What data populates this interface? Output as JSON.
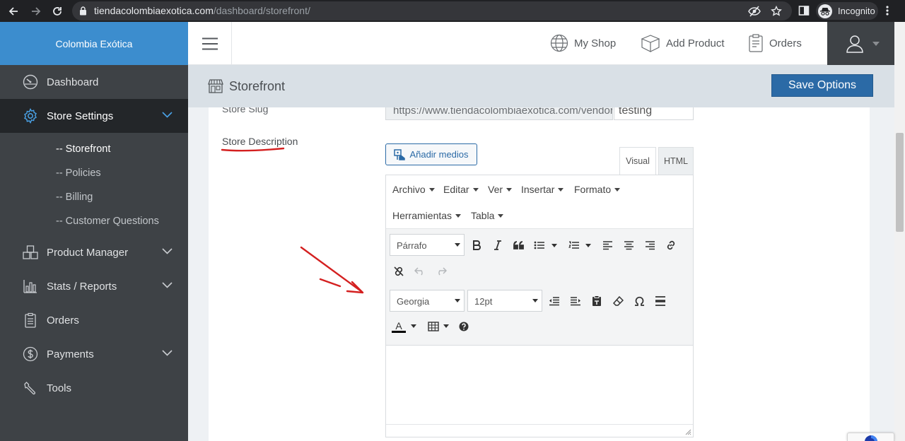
{
  "browser": {
    "url_host": "tiendacolombiaexotica.com",
    "url_path": "/dashboard/storefront/",
    "profile_label": "Incognito"
  },
  "sidebar": {
    "brand": "Colombia Exótica",
    "items": [
      {
        "label": "Dashboard",
        "icon": "dashboard-gauge-icon"
      },
      {
        "label": "Store Settings",
        "icon": "gear-icon",
        "active": true
      },
      {
        "label": "Product Manager",
        "icon": "boxes-icon"
      },
      {
        "label": "Stats / Reports",
        "icon": "bar-chart-icon"
      },
      {
        "label": "Orders",
        "icon": "clipboard-icon"
      },
      {
        "label": "Payments",
        "icon": "dollar-icon"
      },
      {
        "label": "Tools",
        "icon": "wrench-icon"
      }
    ],
    "subitems": [
      "-- Storefront",
      "-- Policies",
      "-- Billing",
      "-- Customer Questions"
    ]
  },
  "topbar": {
    "my_shop": "My Shop",
    "add_product": "Add Product",
    "orders": "Orders"
  },
  "page": {
    "title": "Storefront",
    "save_label": "Save Options"
  },
  "form": {
    "slug_label": "Store Slug",
    "slug_prefix": "https://www.tiendacolombiaexotica.com/vendor/",
    "slug_value": "testing",
    "description_label": "Store Description"
  },
  "editor": {
    "media_button": "Añadir medios",
    "tab_visual": "Visual",
    "tab_html": "HTML",
    "menu": [
      "Archivo",
      "Editar",
      "Ver",
      "Insertar",
      "Formato",
      "Herramientas",
      "Tabla"
    ],
    "block_format": "Párrafo",
    "font_family": "Georgia",
    "font_size": "12pt",
    "text_color_glyph": "A",
    "content": ""
  },
  "colors": {
    "brand_blue": "#3c8dce",
    "sidebar_bg": "#3e4246",
    "save_button": "#2b6aa6",
    "annotation_red": "#d42020"
  }
}
